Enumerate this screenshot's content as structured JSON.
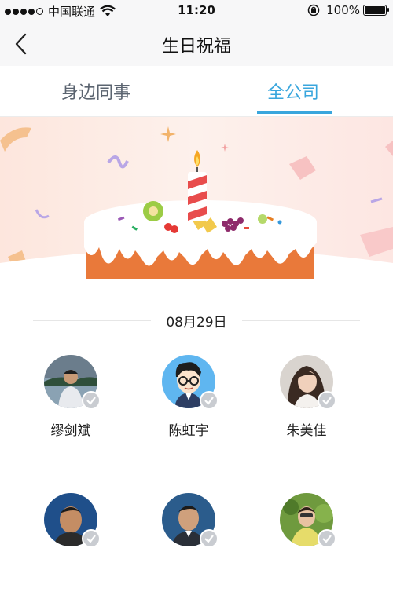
{
  "status_bar": {
    "carrier": "中国联通",
    "time": "11:20",
    "battery": "100%",
    "battery_level": 1.0
  },
  "header": {
    "title": "生日祝福",
    "back_icon": "chevron-left-icon"
  },
  "tabs": [
    {
      "label": "身边同事",
      "active": false
    },
    {
      "label": "全公司",
      "active": true
    }
  ],
  "accent_color": "#39a6dd",
  "date_group": {
    "date": "08月29日"
  },
  "people": [
    {
      "name": "缪剑斌"
    },
    {
      "name": "陈虹宇"
    },
    {
      "name": "朱美佳"
    },
    {
      "name": ""
    },
    {
      "name": ""
    },
    {
      "name": ""
    }
  ]
}
